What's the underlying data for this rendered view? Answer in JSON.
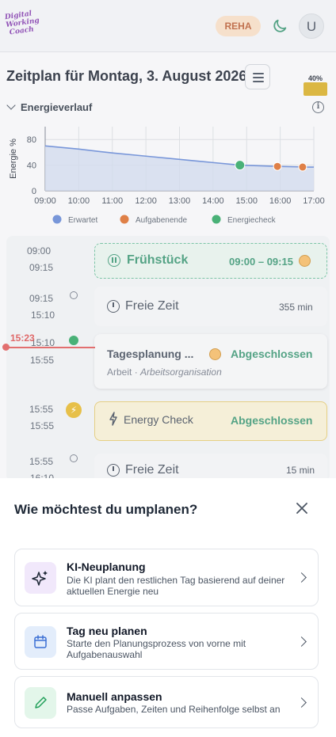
{
  "header": {
    "logo_text": "Digital Working Coach",
    "reha_label": "REHA",
    "avatar_initial": "U"
  },
  "page": {
    "title": "Zeitplan für Montag, 3. August 2026",
    "battery_percent_label": "40%",
    "battery_level": 0.4
  },
  "energy": {
    "section_title": "Energieverlauf"
  },
  "chart_data": {
    "type": "line",
    "ylabel": "Energie %",
    "xlabel": "",
    "x_ticks": [
      "09:00",
      "10:00",
      "11:00",
      "12:00",
      "13:00",
      "14:00",
      "15:00",
      "16:00",
      "17:00"
    ],
    "y_ticks": [
      0,
      40,
      80
    ],
    "ylim": [
      0,
      100
    ],
    "xlim": [
      "09:00",
      "17:00"
    ],
    "series": [
      {
        "name": "Erwartet",
        "color": "#5b7fd1",
        "points": [
          [
            "09:00",
            70
          ],
          [
            "10:00",
            65
          ],
          [
            "11:00",
            59
          ],
          [
            "12:00",
            54
          ],
          [
            "13:00",
            49
          ],
          [
            "14:00",
            44
          ],
          [
            "14:48",
            40
          ],
          [
            "15:55",
            38
          ],
          [
            "16:50",
            37
          ],
          [
            "17:00",
            37
          ]
        ]
      }
    ],
    "markers": [
      {
        "name": "Energiecheck",
        "color": "#22a05a",
        "x": "14:48",
        "y": 40
      },
      {
        "name": "Aufgabenende",
        "color": "#d8641f",
        "x": "15:55",
        "y": 38
      },
      {
        "name": "Aufgabenende",
        "color": "#d8641f",
        "x": "16:40",
        "y": 37
      }
    ],
    "legend": [
      {
        "label": "Erwartet",
        "color": "#5b7fd1"
      },
      {
        "label": "Aufgabenende",
        "color": "#d8641f"
      },
      {
        "label": "Energiecheck",
        "color": "#22a05a"
      }
    ],
    "legend_position": "bottom",
    "grid": true
  },
  "schedule": {
    "now_time": "15:23",
    "items": [
      {
        "start": "09:00",
        "end": "09:15",
        "title": "Frühstück",
        "range": "09:00 – 09:15"
      },
      {
        "start": "09:15",
        "end": "15:10",
        "title": "Freie Zeit",
        "duration": "355 min"
      },
      {
        "start": "15:10",
        "end": "15:55",
        "title": "Tagesplanung ...",
        "status": "Abgeschlossen",
        "category": "Arbeit",
        "subcategory": "Arbeitsorganisation"
      },
      {
        "start": "15:55",
        "end": "15:55",
        "title": "Energy Check",
        "status": "Abgeschlossen"
      },
      {
        "start": "15:55",
        "end": "16:10",
        "title": "Freie Zeit",
        "duration": "15 min"
      }
    ]
  },
  "sheet": {
    "title": "Wie möchtest du umplanen?",
    "options": [
      {
        "title": "KI-Neuplanung",
        "desc": "Die KI plant den restlichen Tag basierend auf deiner aktuellen Energie neu",
        "icon": "sparkles-icon",
        "icon_bg": "#f1e8fb"
      },
      {
        "title": "Tag neu planen",
        "desc": "Starte den Planungsprozess von vorne mit Aufgabenauswahl",
        "icon": "calendar-icon",
        "icon_bg": "#e3edfb"
      },
      {
        "title": "Manuell anpassen",
        "desc": "Passe Aufgaben, Zeiten und Reihenfolge selbst an",
        "icon": "pencil-icon",
        "icon_bg": "#e3f6ea"
      }
    ]
  }
}
